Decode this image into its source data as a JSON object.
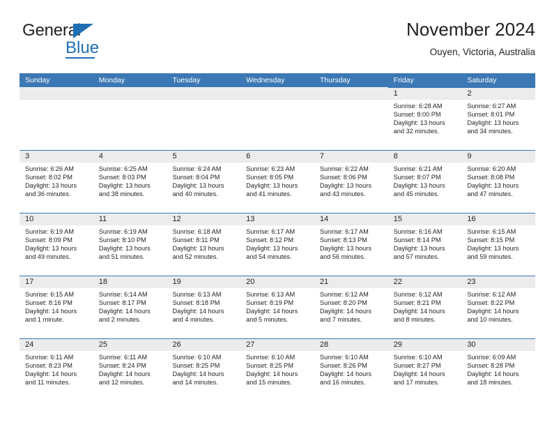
{
  "logo": {
    "word1": "General",
    "word2": "Blue",
    "triangle_icon": "blue-triangle-icon",
    "accent_color": "#1f6fb5"
  },
  "header": {
    "title": "November 2024",
    "subtitle": "Ouyen, Victoria, Australia"
  },
  "calendar": {
    "header_bg": "#3c78b4",
    "cell_head_bg": "#ececec",
    "day_names": [
      "Sunday",
      "Monday",
      "Tuesday",
      "Wednesday",
      "Thursday",
      "Friday",
      "Saturday"
    ],
    "labels": {
      "sunrise": "Sunrise:",
      "sunset": "Sunset:",
      "daylight": "Daylight:"
    },
    "weeks": [
      [
        {
          "empty": true
        },
        {
          "empty": true
        },
        {
          "empty": true
        },
        {
          "empty": true
        },
        {
          "empty": true
        },
        {
          "day": "1",
          "sunrise": "Sunrise: 6:28 AM",
          "sunset": "Sunset: 8:00 PM",
          "daylight": "Daylight: 13 hours and 32 minutes."
        },
        {
          "day": "2",
          "sunrise": "Sunrise: 6:27 AM",
          "sunset": "Sunset: 8:01 PM",
          "daylight": "Daylight: 13 hours and 34 minutes."
        }
      ],
      [
        {
          "day": "3",
          "sunrise": "Sunrise: 6:26 AM",
          "sunset": "Sunset: 8:02 PM",
          "daylight": "Daylight: 13 hours and 36 minutes."
        },
        {
          "day": "4",
          "sunrise": "Sunrise: 6:25 AM",
          "sunset": "Sunset: 8:03 PM",
          "daylight": "Daylight: 13 hours and 38 minutes."
        },
        {
          "day": "5",
          "sunrise": "Sunrise: 6:24 AM",
          "sunset": "Sunset: 8:04 PM",
          "daylight": "Daylight: 13 hours and 40 minutes."
        },
        {
          "day": "6",
          "sunrise": "Sunrise: 6:23 AM",
          "sunset": "Sunset: 8:05 PM",
          "daylight": "Daylight: 13 hours and 41 minutes."
        },
        {
          "day": "7",
          "sunrise": "Sunrise: 6:22 AM",
          "sunset": "Sunset: 8:06 PM",
          "daylight": "Daylight: 13 hours and 43 minutes."
        },
        {
          "day": "8",
          "sunrise": "Sunrise: 6:21 AM",
          "sunset": "Sunset: 8:07 PM",
          "daylight": "Daylight: 13 hours and 45 minutes."
        },
        {
          "day": "9",
          "sunrise": "Sunrise: 6:20 AM",
          "sunset": "Sunset: 8:08 PM",
          "daylight": "Daylight: 13 hours and 47 minutes."
        }
      ],
      [
        {
          "day": "10",
          "sunrise": "Sunrise: 6:19 AM",
          "sunset": "Sunset: 8:09 PM",
          "daylight": "Daylight: 13 hours and 49 minutes."
        },
        {
          "day": "11",
          "sunrise": "Sunrise: 6:19 AM",
          "sunset": "Sunset: 8:10 PM",
          "daylight": "Daylight: 13 hours and 51 minutes."
        },
        {
          "day": "12",
          "sunrise": "Sunrise: 6:18 AM",
          "sunset": "Sunset: 8:11 PM",
          "daylight": "Daylight: 13 hours and 52 minutes."
        },
        {
          "day": "13",
          "sunrise": "Sunrise: 6:17 AM",
          "sunset": "Sunset: 8:12 PM",
          "daylight": "Daylight: 13 hours and 54 minutes."
        },
        {
          "day": "14",
          "sunrise": "Sunrise: 6:17 AM",
          "sunset": "Sunset: 8:13 PM",
          "daylight": "Daylight: 13 hours and 56 minutes."
        },
        {
          "day": "15",
          "sunrise": "Sunrise: 6:16 AM",
          "sunset": "Sunset: 8:14 PM",
          "daylight": "Daylight: 13 hours and 57 minutes."
        },
        {
          "day": "16",
          "sunrise": "Sunrise: 6:15 AM",
          "sunset": "Sunset: 8:15 PM",
          "daylight": "Daylight: 13 hours and 59 minutes."
        }
      ],
      [
        {
          "day": "17",
          "sunrise": "Sunrise: 6:15 AM",
          "sunset": "Sunset: 8:16 PM",
          "daylight": "Daylight: 14 hours and 1 minute."
        },
        {
          "day": "18",
          "sunrise": "Sunrise: 6:14 AM",
          "sunset": "Sunset: 8:17 PM",
          "daylight": "Daylight: 14 hours and 2 minutes."
        },
        {
          "day": "19",
          "sunrise": "Sunrise: 6:13 AM",
          "sunset": "Sunset: 8:18 PM",
          "daylight": "Daylight: 14 hours and 4 minutes."
        },
        {
          "day": "20",
          "sunrise": "Sunrise: 6:13 AM",
          "sunset": "Sunset: 8:19 PM",
          "daylight": "Daylight: 14 hours and 5 minutes."
        },
        {
          "day": "21",
          "sunrise": "Sunrise: 6:12 AM",
          "sunset": "Sunset: 8:20 PM",
          "daylight": "Daylight: 14 hours and 7 minutes."
        },
        {
          "day": "22",
          "sunrise": "Sunrise: 6:12 AM",
          "sunset": "Sunset: 8:21 PM",
          "daylight": "Daylight: 14 hours and 8 minutes."
        },
        {
          "day": "23",
          "sunrise": "Sunrise: 6:12 AM",
          "sunset": "Sunset: 8:22 PM",
          "daylight": "Daylight: 14 hours and 10 minutes."
        }
      ],
      [
        {
          "day": "24",
          "sunrise": "Sunrise: 6:11 AM",
          "sunset": "Sunset: 8:23 PM",
          "daylight": "Daylight: 14 hours and 11 minutes."
        },
        {
          "day": "25",
          "sunrise": "Sunrise: 6:11 AM",
          "sunset": "Sunset: 8:24 PM",
          "daylight": "Daylight: 14 hours and 12 minutes."
        },
        {
          "day": "26",
          "sunrise": "Sunrise: 6:10 AM",
          "sunset": "Sunset: 8:25 PM",
          "daylight": "Daylight: 14 hours and 14 minutes."
        },
        {
          "day": "27",
          "sunrise": "Sunrise: 6:10 AM",
          "sunset": "Sunset: 8:25 PM",
          "daylight": "Daylight: 14 hours and 15 minutes."
        },
        {
          "day": "28",
          "sunrise": "Sunrise: 6:10 AM",
          "sunset": "Sunset: 8:26 PM",
          "daylight": "Daylight: 14 hours and 16 minutes."
        },
        {
          "day": "29",
          "sunrise": "Sunrise: 6:10 AM",
          "sunset": "Sunset: 8:27 PM",
          "daylight": "Daylight: 14 hours and 17 minutes."
        },
        {
          "day": "30",
          "sunrise": "Sunrise: 6:09 AM",
          "sunset": "Sunset: 8:28 PM",
          "daylight": "Daylight: 14 hours and 18 minutes."
        }
      ]
    ]
  }
}
